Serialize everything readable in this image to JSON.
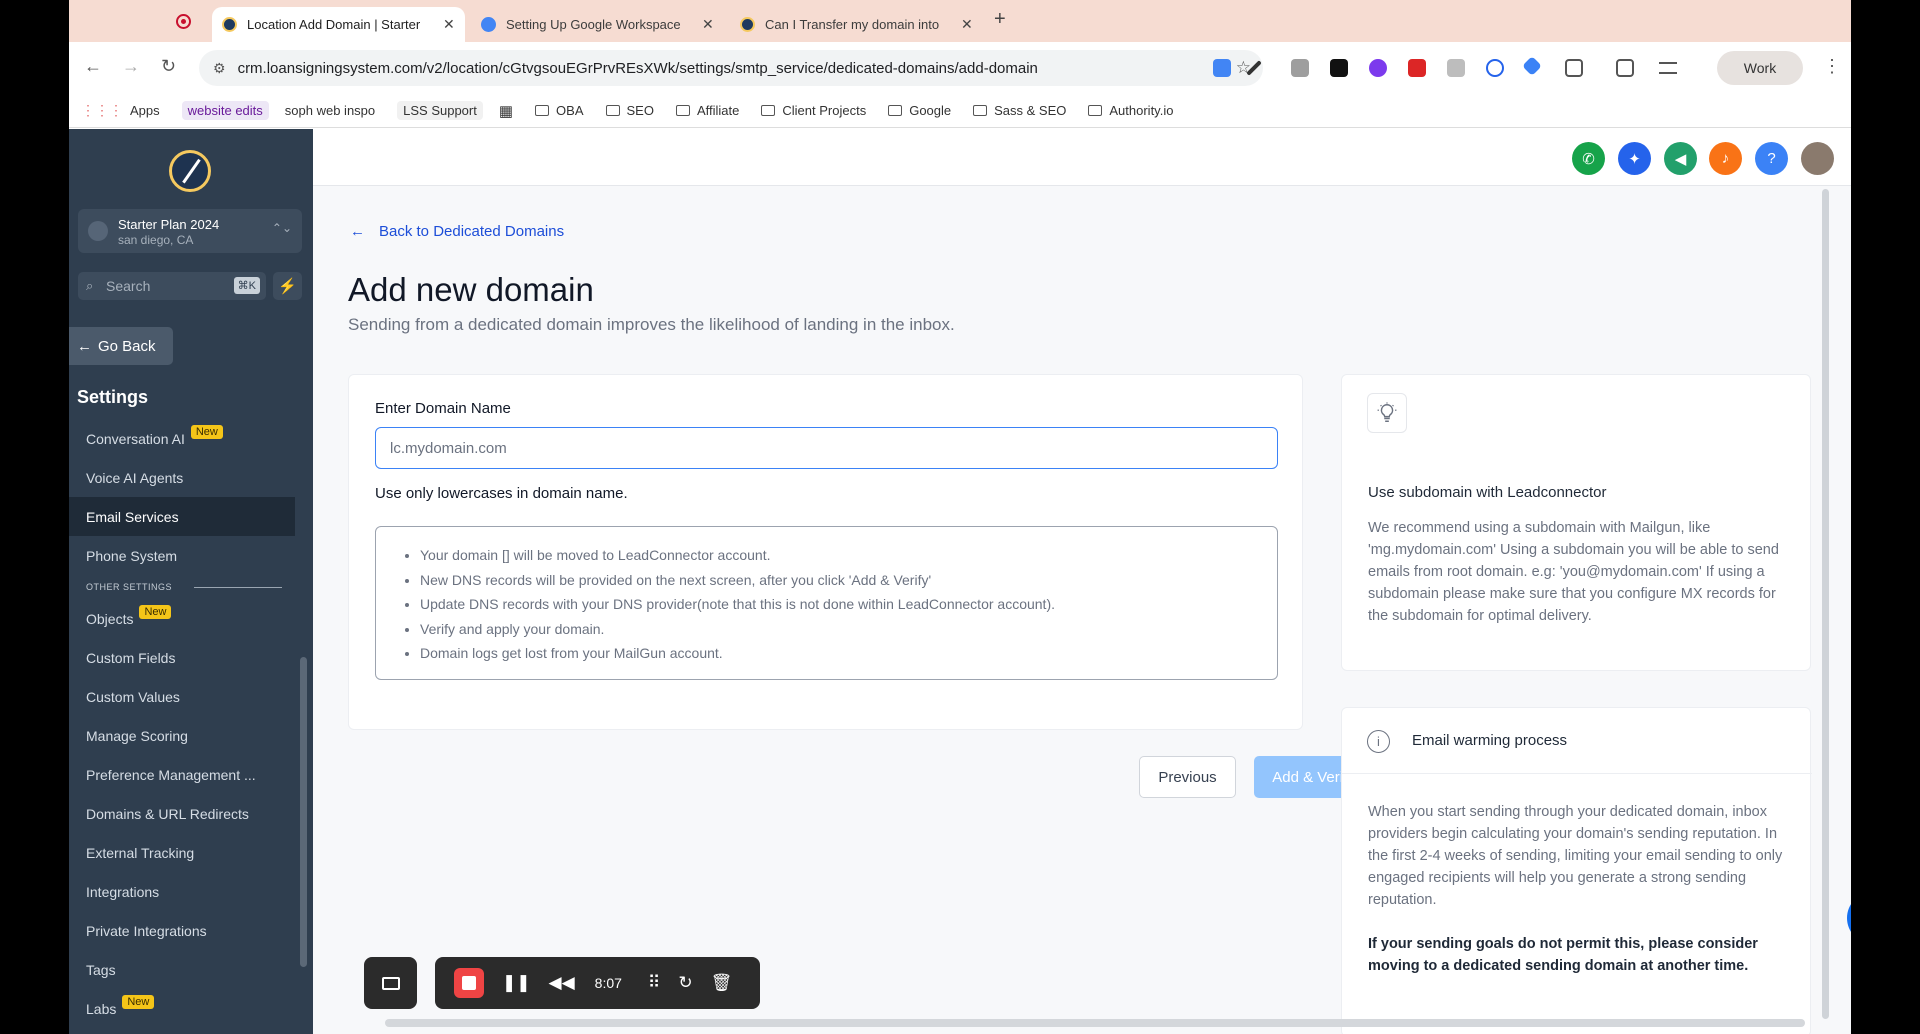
{
  "browser": {
    "tabs": [
      {
        "title": "Location Add Domain | Starter",
        "active": true,
        "favicon_color": "#1e3a5f"
      },
      {
        "title": "Setting Up Google Workspace",
        "active": false,
        "favicon_color": "#4285f4"
      },
      {
        "title": "Can I Transfer my domain into",
        "active": false,
        "favicon_color": "#1e3a5f"
      }
    ],
    "url": "crm.loansigningsystem.com/v2/location/cGtvgsouEGrPrvREsXWk/settings/smtp_service/dedicated-domains/add-domain",
    "profile_label": "Work"
  },
  "bookmarks": {
    "apps": "Apps",
    "website_edits": "website edits",
    "soph": "soph web inspo",
    "lss": "LSS Support",
    "folders": [
      "OBA",
      "SEO",
      "Affiliate",
      "Client Projects",
      "Google",
      "Sass & SEO",
      "Authority.io"
    ]
  },
  "sidebar": {
    "account_name": "Starter Plan 2024",
    "account_location": "san diego, CA",
    "search_placeholder": "Search",
    "search_shortcut": "⌘K",
    "go_back": "Go Back",
    "settings_heading": "Settings",
    "other_settings_label": "OTHER SETTINGS",
    "new_badge": "New",
    "items": [
      {
        "label": "Conversation AI",
        "new": true
      },
      {
        "label": "Voice AI Agents",
        "new": false
      },
      {
        "label": "Email Services",
        "new": false,
        "active": true
      },
      {
        "label": "Phone System",
        "new": false
      }
    ],
    "other_items": [
      {
        "label": "Objects",
        "new": true
      },
      {
        "label": "Custom Fields",
        "new": false
      },
      {
        "label": "Custom Values",
        "new": false
      },
      {
        "label": "Manage Scoring",
        "new": false
      },
      {
        "label": "Preference Management ...",
        "new": false
      },
      {
        "label": "Domains & URL Redirects",
        "new": false
      },
      {
        "label": "External Tracking",
        "new": false
      },
      {
        "label": "Integrations",
        "new": false
      },
      {
        "label": "Private Integrations",
        "new": false
      },
      {
        "label": "Tags",
        "new": false
      },
      {
        "label": "Labs",
        "new": true
      }
    ]
  },
  "topbar_icons": [
    {
      "name": "phone-icon",
      "color": "#16a34a",
      "glyph": "✆"
    },
    {
      "name": "magic-icon",
      "color": "#2563eb",
      "glyph": "✦"
    },
    {
      "name": "megaphone-icon",
      "color": "#22a06b",
      "glyph": "📣"
    },
    {
      "name": "bell-icon",
      "color": "#f97316",
      "glyph": "🔔"
    },
    {
      "name": "help-icon",
      "color": "#3b82f6",
      "glyph": "?"
    }
  ],
  "page": {
    "back_link": "Back to Dedicated Domains",
    "title": "Add new domain",
    "subtitle": "Sending from a dedicated domain improves the likelihood of landing in the inbox.",
    "field_label": "Enter Domain Name",
    "input_placeholder": "lc.mydomain.com",
    "input_value": "",
    "hint": "Use only lowercases in domain name.",
    "notes": [
      "Your domain [] will be moved to LeadConnector account.",
      "New DNS records will be provided on the next screen, after you click 'Add & Verify'",
      "Update DNS records with your DNS provider(note that this is not done within LeadConnector account).",
      "Verify and apply your domain.",
      "Domain logs get lost from your MailGun account."
    ],
    "previous_button": "Previous",
    "add_verify_button": "Add & Verify"
  },
  "tip_card": {
    "title": "Use subdomain with Leadconnector",
    "text": "We recommend using a subdomain with Mailgun, like 'mg.mydomain.com' Using a subdomain you will be able to send emails from root domain. e.g: 'you@mydomain.com' If using a subdomain please make sure that you configure MX records for the subdomain for optimal delivery."
  },
  "warm_card": {
    "title": "Email warming process",
    "text": "When you start sending through your dedicated domain, inbox providers begin calculating your domain's sending reputation. In the first 2-4 weeks of sending, limiting your email sending to only engaged recipients will help you generate a strong sending reputation.",
    "bold_text": "If your sending goals do not permit this, please consider moving to a dedicated sending domain at another time."
  },
  "recorder": {
    "time": "8:07"
  },
  "colors": {
    "sidebar_bg": "#2f3e4f",
    "accent": "#3b82f6",
    "link": "#1d4ed8",
    "disabled_primary": "#93c5fd"
  }
}
